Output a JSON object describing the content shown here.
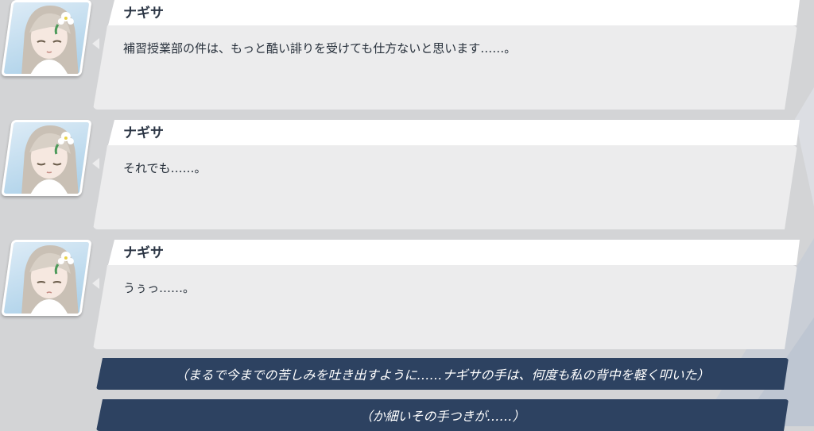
{
  "messages": [
    {
      "speaker": "ナギサ",
      "text": "補習授業部の件は、もっと酷い誹りを受けても仕方ないと思います……。"
    },
    {
      "speaker": "ナギサ",
      "text": "それでも……。"
    },
    {
      "speaker": "ナギサ",
      "text": "うぅっ……。"
    }
  ],
  "narration": [
    "（まるで今までの苦しみを吐き出すように……ナギサの手は、何度も私の背中を軽く叩いた）",
    "（か細いその手つきが……）"
  ],
  "icons": {
    "avatar": "nagisa-portrait"
  },
  "colors": {
    "background": "#d3d4d6",
    "name_panel": "#ffffff",
    "text_panel": "#ececed",
    "narration_bar": "#2d4261",
    "text": "#27303b"
  }
}
